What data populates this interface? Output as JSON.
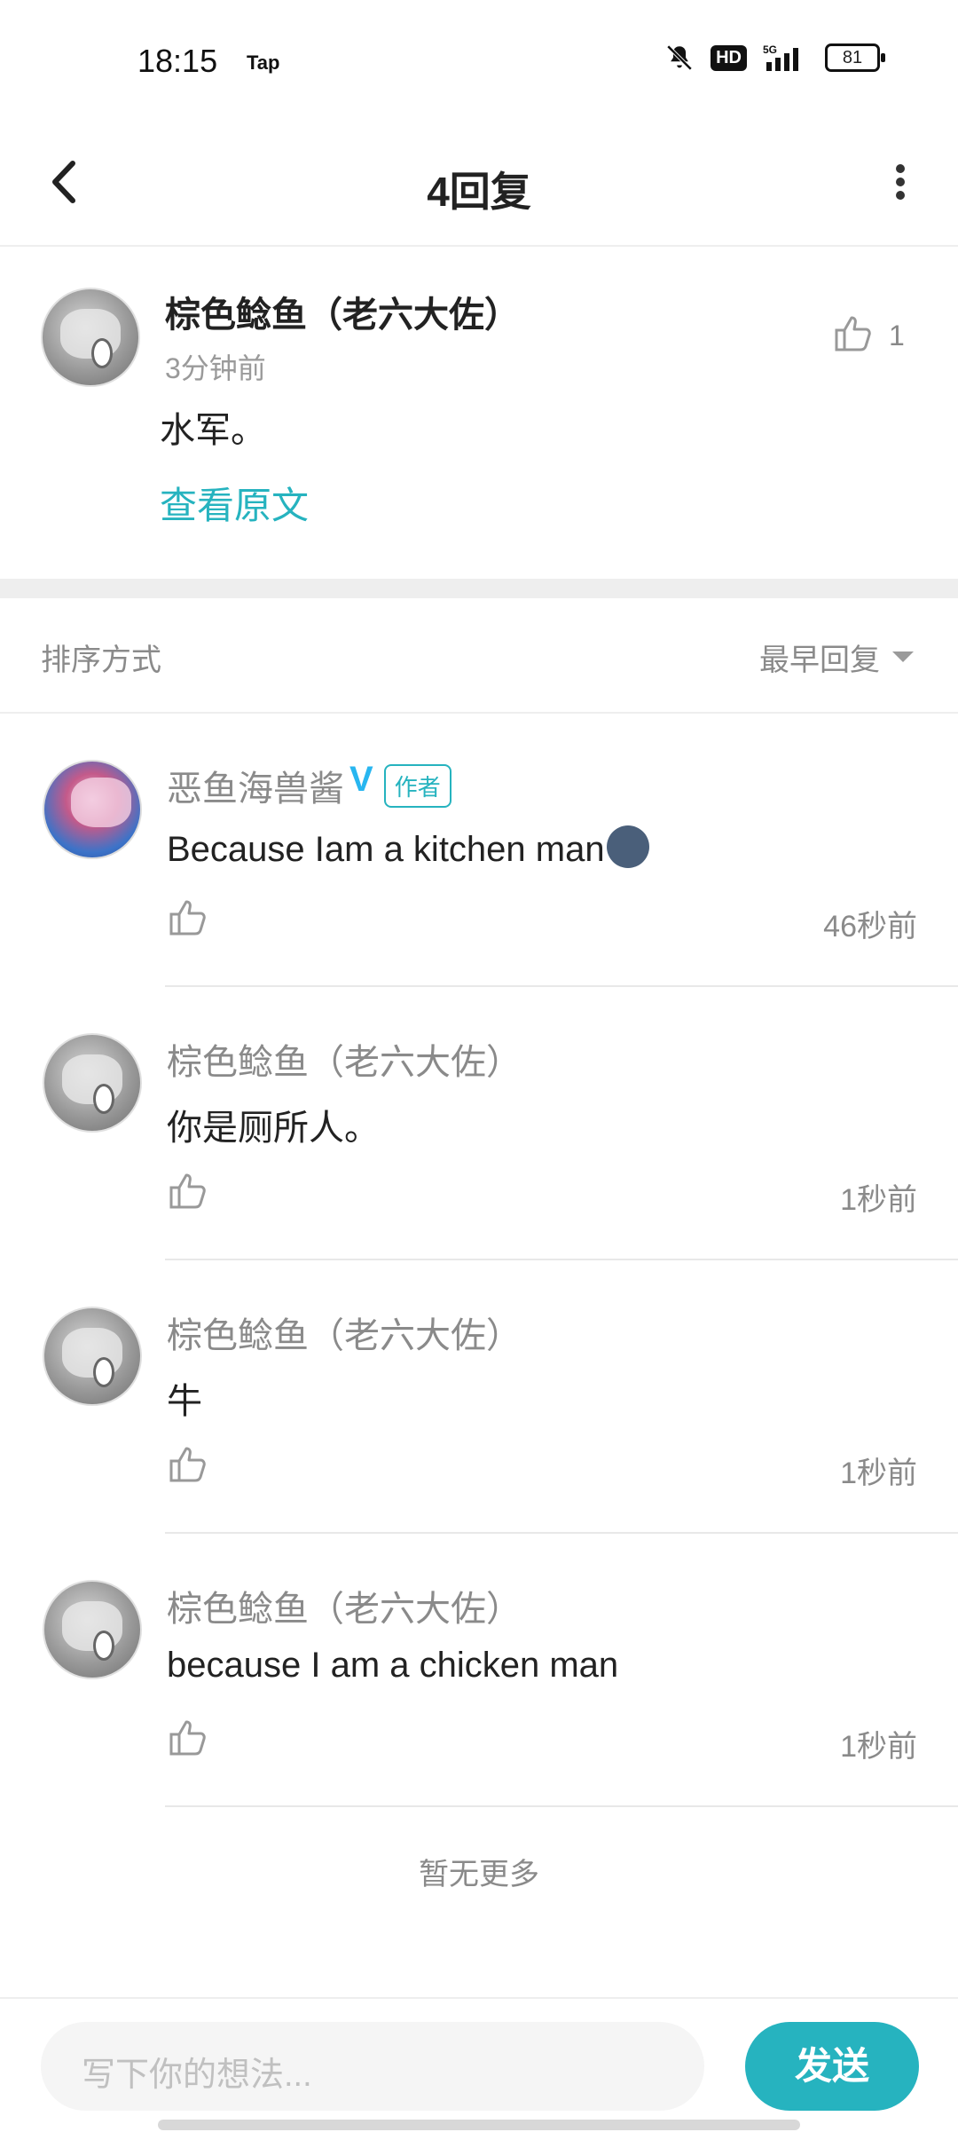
{
  "status_bar": {
    "time": "18:15",
    "app_tag": "Tap",
    "hd": "HD",
    "network": "5G",
    "battery": "81"
  },
  "header": {
    "title": "4回复"
  },
  "main_post": {
    "author": "棕色鲶鱼（老六大佐）",
    "time": "3分钟前",
    "content": "水军。",
    "view_original": "查看原文",
    "like_count": "1"
  },
  "sort": {
    "label": "排序方式",
    "value": "最早回复"
  },
  "replies": [
    {
      "author": "恶鱼海兽酱",
      "verified": "V",
      "tag": "作者",
      "text": "Because Iam a kitchen man",
      "time": "46秒前"
    },
    {
      "author": "棕色鲶鱼（老六大佐）",
      "text": "你是厕所人。",
      "time": "1秒前"
    },
    {
      "author": "棕色鲶鱼（老六大佐）",
      "text": "牛",
      "time": "1秒前"
    },
    {
      "author": "棕色鲶鱼（老六大佐）",
      "text": "because I am a chicken man",
      "time": "1秒前"
    }
  ],
  "footer": {
    "no_more": "暂无更多"
  },
  "composer": {
    "placeholder": "写下你的想法...",
    "send_label": "发送"
  },
  "colors": {
    "accent": "#26b3bf",
    "verified": "#28b6f0"
  }
}
